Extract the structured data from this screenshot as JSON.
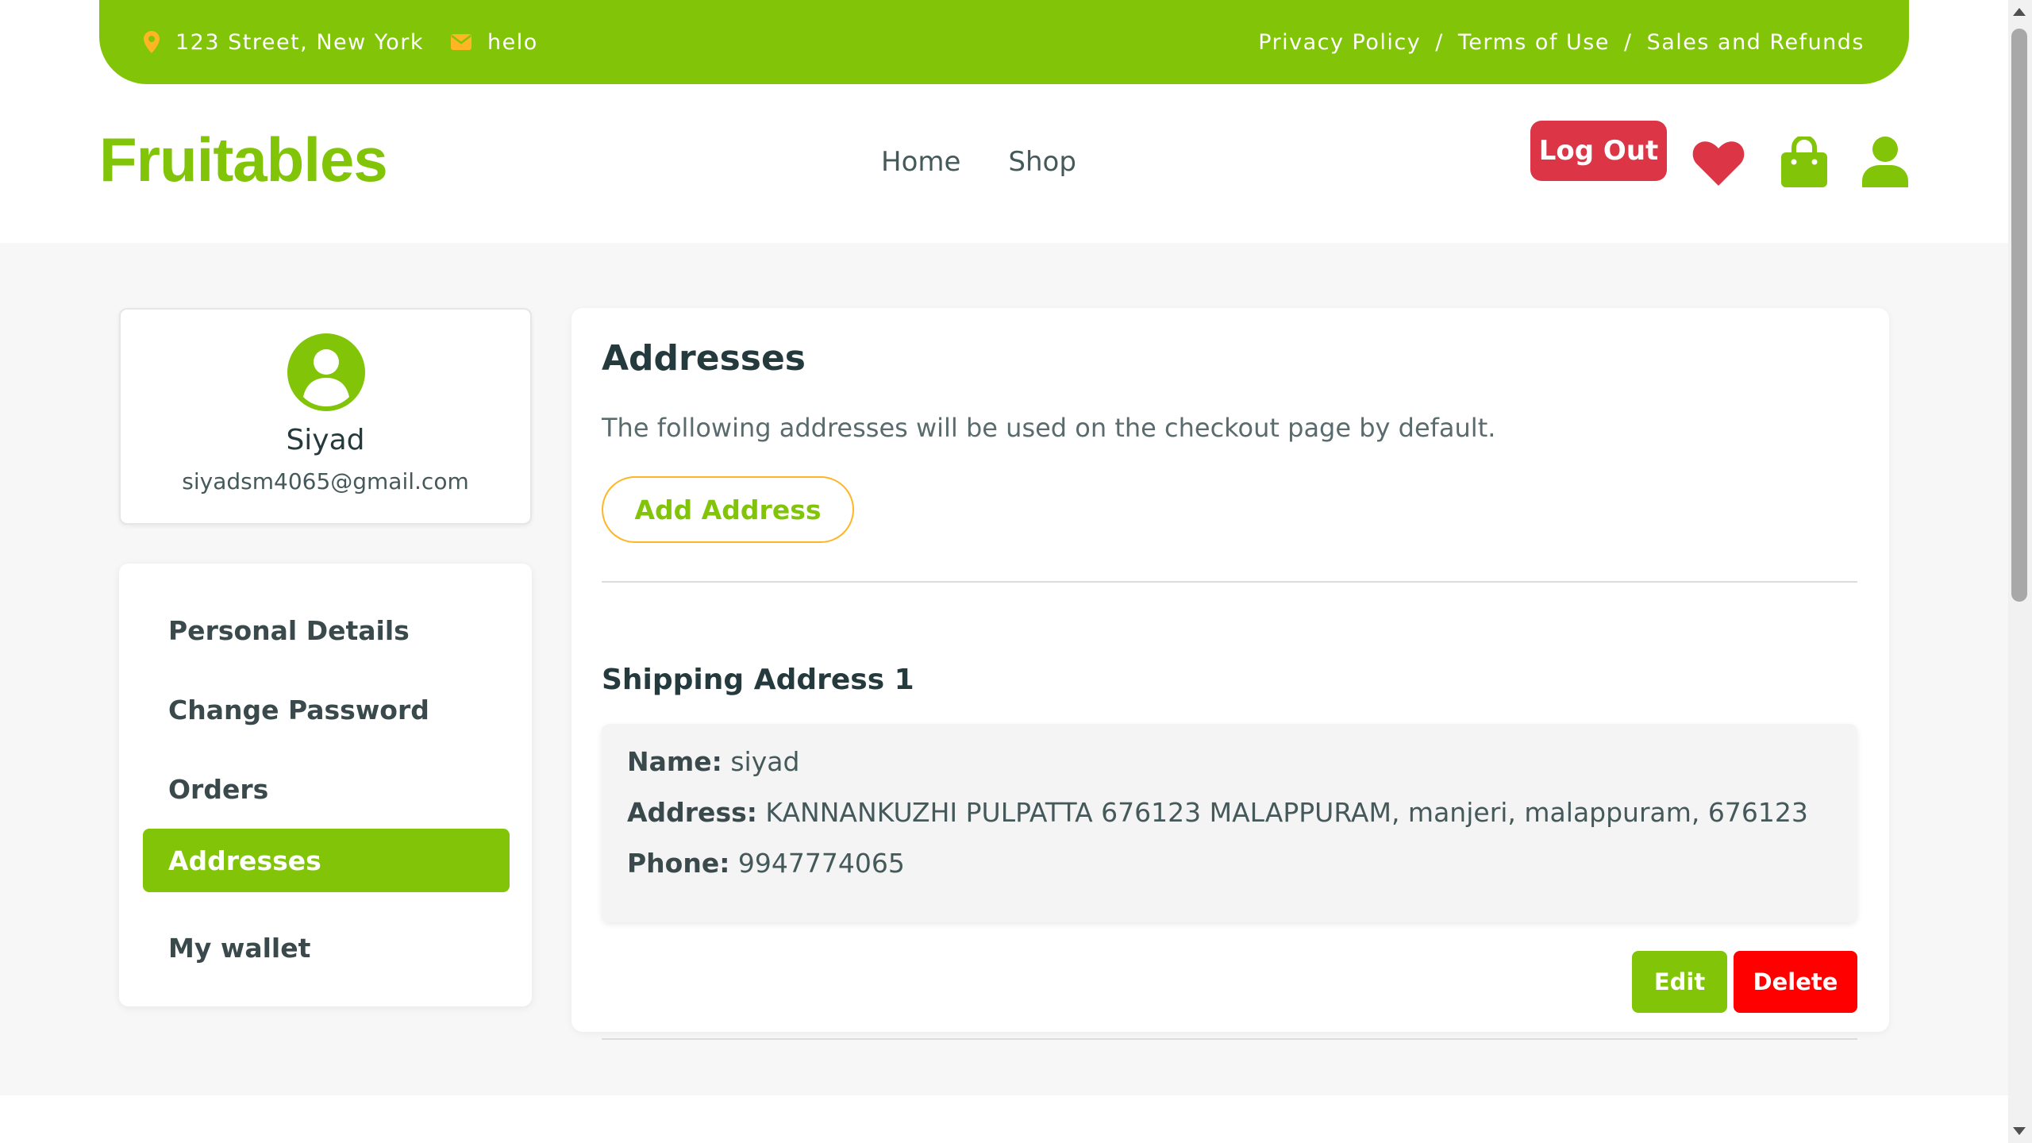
{
  "topbar": {
    "location": "123 Street, New York",
    "email": "helo",
    "links": [
      "Privacy Policy",
      "Terms of Use",
      "Sales and Refunds"
    ],
    "separator": "/"
  },
  "header": {
    "brand": "Fruitables",
    "nav": [
      "Home",
      "Shop"
    ],
    "logout_label": "Log Out",
    "icons": [
      "heart-icon",
      "shopping-bag-icon",
      "user-icon"
    ]
  },
  "profile": {
    "name": "Siyad",
    "email": "siyadsm4065@gmail.com"
  },
  "sidebar": {
    "items": [
      {
        "label": "Personal Details"
      },
      {
        "label": "Change Password"
      },
      {
        "label": "Orders"
      },
      {
        "label": "Addresses",
        "active": true
      },
      {
        "label": "My wallet"
      }
    ]
  },
  "content": {
    "title": "Addresses",
    "description": "The following addresses will be used on the checkout page by default.",
    "add_button": "Add Address",
    "addresses": [
      {
        "heading": "Shipping Address 1",
        "name_label": "Name:",
        "name": "siyad",
        "address_label": "Address:",
        "address": "KANNANKUZHI PULPATTA 676123 MALAPPURAM, manjeri, malappuram, 676123",
        "phone_label": "Phone:",
        "phone": "9947774065",
        "edit_label": "Edit",
        "delete_label": "Delete"
      }
    ]
  },
  "colors": {
    "brand_green": "#81c408",
    "accent_yellow": "#ffb524",
    "logout_red": "#dc3545",
    "delete_red": "#ff0000"
  }
}
